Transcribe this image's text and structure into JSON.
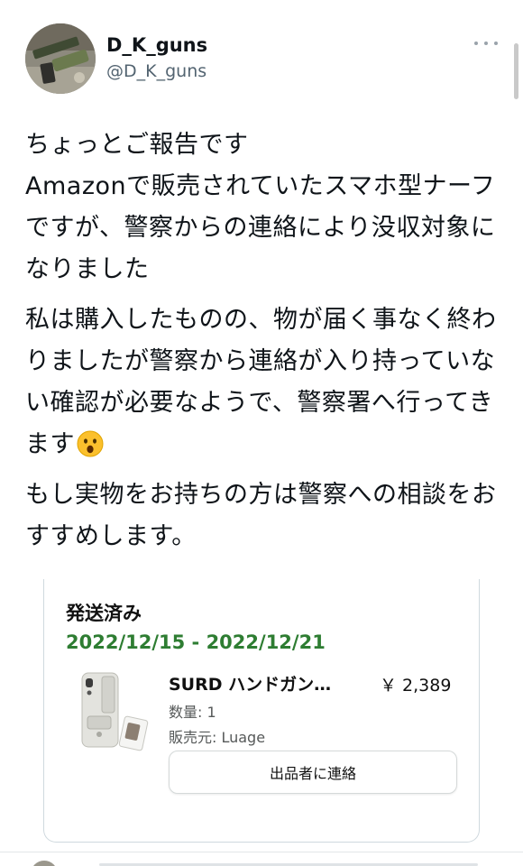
{
  "user": {
    "display_name": "D_K_guns",
    "handle": "@D_K_guns"
  },
  "tweet": {
    "paragraphs": [
      "ちょっとご報告です\nAmazonで販売されていたスマホ型ナーフですが、警察からの連絡により没収対象になりました",
      "私は購入したものの、物が届く事なく終わりましたが警察から連絡が入り持っていない確認が必要なようで、警察署へ行ってきます",
      "もし実物をお持ちの方は警察への相談をおすすめします。"
    ],
    "emoji": "face-open-mouth"
  },
  "order_card": {
    "status": "発送済み",
    "dates": "2022/12/15 - 2022/12/21",
    "product_name": "SURD ハンドガン…",
    "price": "￥ 2,389",
    "quantity": "数量: 1",
    "seller": "販売元: Luage",
    "contact_button": "出品者に連絡"
  },
  "colors": {
    "dates_green": "#2e7d32",
    "handle_gray": "#536471"
  }
}
